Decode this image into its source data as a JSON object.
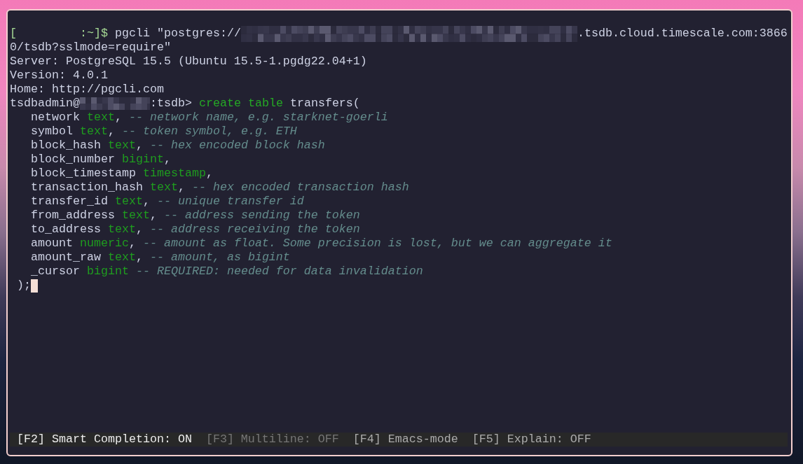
{
  "terminal": {
    "shell_line": {
      "prompt_open": "[",
      "prompt_close": ":~]$",
      "command": "pgcli \"postgres://",
      "redacted": true,
      "command_tail": ".tsdb.cloud.timescale.com:3866"
    },
    "wrapped_line": "0/tsdb?sslmode=require\"",
    "output_lines": [
      "Server: PostgreSQL 15.5 (Ubuntu 15.5-1.pgdg22.04+1)",
      "Version: 4.0.1",
      "Home: http://pgcli.com"
    ],
    "sql_prompt": {
      "user": "tsdbadmin@",
      "redacted": true,
      "database": ":tsdb>"
    },
    "statement": {
      "keywords": "create table",
      "table": "transfers(",
      "columns": [
        {
          "name": "network",
          "type": "text",
          "separator": ",",
          "comment": "-- network name, e.g. starknet-goerli"
        },
        {
          "name": "symbol",
          "type": "text",
          "separator": ",",
          "comment": "-- token symbol, e.g. ETH"
        },
        {
          "name": "block_hash",
          "type": "text",
          "separator": ",",
          "comment": "-- hex encoded block hash"
        },
        {
          "name": "block_number",
          "type": "bigint",
          "separator": ","
        },
        {
          "name": "block_timestamp",
          "type": "timestamp",
          "separator": ","
        },
        {
          "name": "transaction_hash",
          "type": "text",
          "separator": ",",
          "comment": "-- hex encoded transaction hash"
        },
        {
          "name": "transfer_id",
          "type": "text",
          "separator": ",",
          "comment": "-- unique transfer id"
        },
        {
          "name": "from_address",
          "type": "text",
          "separator": ",",
          "comment": "-- address sending the token"
        },
        {
          "name": "to_address",
          "type": "text",
          "separator": ",",
          "comment": "-- address receiving the token"
        },
        {
          "name": "amount",
          "type": "numeric",
          "separator": ",",
          "comment": "-- amount as float. Some precision is lost, but we can aggregate it"
        },
        {
          "name": "amount_raw",
          "type": "text",
          "separator": ",",
          "comment": "-- amount, as bigint"
        },
        {
          "name": "_cursor",
          "type": "bigint",
          "comment": "-- REQUIRED: needed for data invalidation"
        }
      ],
      "closing": ");"
    },
    "cursor_visible": true
  },
  "toolbar": {
    "items": [
      {
        "text": "[F2] Smart Completion: ON",
        "kind": "on"
      },
      {
        "text": "[F3] Multiline: OFF",
        "kind": "off"
      },
      {
        "text": "[F4] Emacs-mode",
        "kind": "neutral"
      },
      {
        "text": "[F5] Explain: OFF",
        "kind": "neutral"
      }
    ]
  }
}
